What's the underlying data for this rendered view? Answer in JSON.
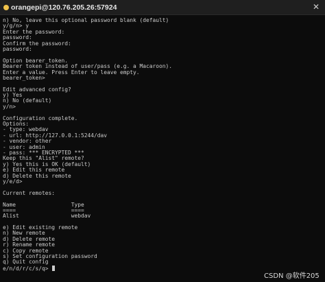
{
  "window": {
    "title": "orangepi@120.76.205.26:57924",
    "close_glyph": "✕",
    "status_color": "#f0c24a"
  },
  "terminal": {
    "text_color": "#cccccc",
    "cursor_color": "#cccccc",
    "lines": [
      "n) No, leave this optional password blank (default)",
      "y/g/n> y",
      "Enter the password:",
      "password:",
      "Confirm the password:",
      "password:",
      "",
      "Option bearer_token.",
      "Bearer token instead of user/pass (e.g. a Macaroon).",
      "Enter a value. Press Enter to leave empty.",
      "bearer_token>",
      "",
      "Edit advanced config?",
      "y) Yes",
      "n) No (default)",
      "y/n>",
      "",
      "Configuration complete.",
      "Options:",
      "- type: webdav",
      "- url: http://127.0.0.1:5244/dav",
      "- vendor: other",
      "- user: admin",
      "- pass: *** ENCRYPTED ***",
      "Keep this \"Alist\" remote?",
      "y) Yes this is OK (default)",
      "e) Edit this remote",
      "d) Delete this remote",
      "y/e/d>",
      "",
      "Current remotes:",
      "",
      "Name                 Type",
      "====                 ====",
      "Alist                webdav",
      "",
      "e) Edit existing remote",
      "n) New remote",
      "d) Delete remote",
      "r) Rename remote",
      "c) Copy remote",
      "s) Set configuration password",
      "q) Quit config",
      "e/n/d/r/c/s/q> "
    ]
  },
  "watermark": {
    "text": "CSDN @软件205"
  }
}
